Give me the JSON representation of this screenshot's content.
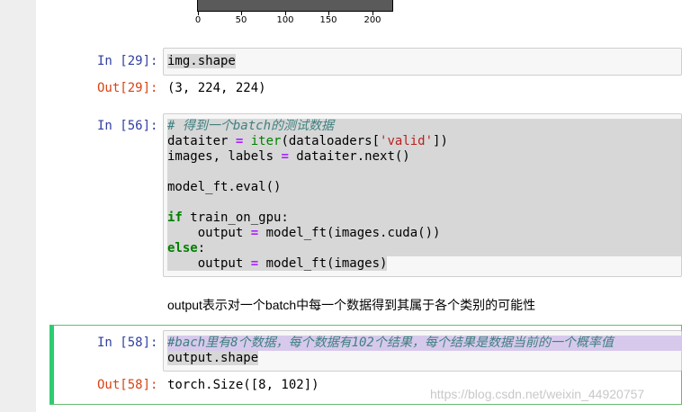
{
  "plot_axis": {
    "ticks": [
      "0",
      "50",
      "100",
      "150",
      "200"
    ]
  },
  "cells": {
    "c29": {
      "in_prompt": "In [29]:",
      "code": "img.shape",
      "out_prompt": "Out[29]:",
      "output": "(3, 224, 224)"
    },
    "c56": {
      "in_prompt": "In [56]:",
      "comment": "# 得到一个batch的测试数据",
      "l2_a": "dataiter ",
      "l2_op": "=",
      "l2_fn": "iter",
      "l2_b": "(dataloaders[",
      "l2_str": "'valid'",
      "l2_c": "])",
      "l3_a": "images, labels ",
      "l3_op": "=",
      "l3_b": " dataiter.next()",
      "l5": "model_ft.eval()",
      "l7_kw": "if",
      "l7_b": " train_on_gpu:",
      "l8_a": "    output ",
      "l8_op": "=",
      "l8_b": " model_ft(images.cuda())",
      "l9_kw": "else",
      "l9_b": ":",
      "l10_a": "    output ",
      "l10_op": "=",
      "l10_b": " model_ft(images)"
    },
    "markdown": {
      "text": "output表示对一个batch中每一个数据得到其属于各个类别的可能性"
    },
    "c58": {
      "in_prompt": "In [58]:",
      "comment": "#bach里有8个数据，每个数据有102个结果，每个结果是数据当前的一个概率值",
      "code": "output.shape",
      "out_prompt": "Out[58]:",
      "output": "torch.Size([8, 102])"
    }
  },
  "watermark": "https://blog.csdn.net/weixin_44920757",
  "colors": {
    "in_prompt": "#303f9f",
    "out_prompt": "#d84315",
    "active_border": "#2ecc71"
  }
}
